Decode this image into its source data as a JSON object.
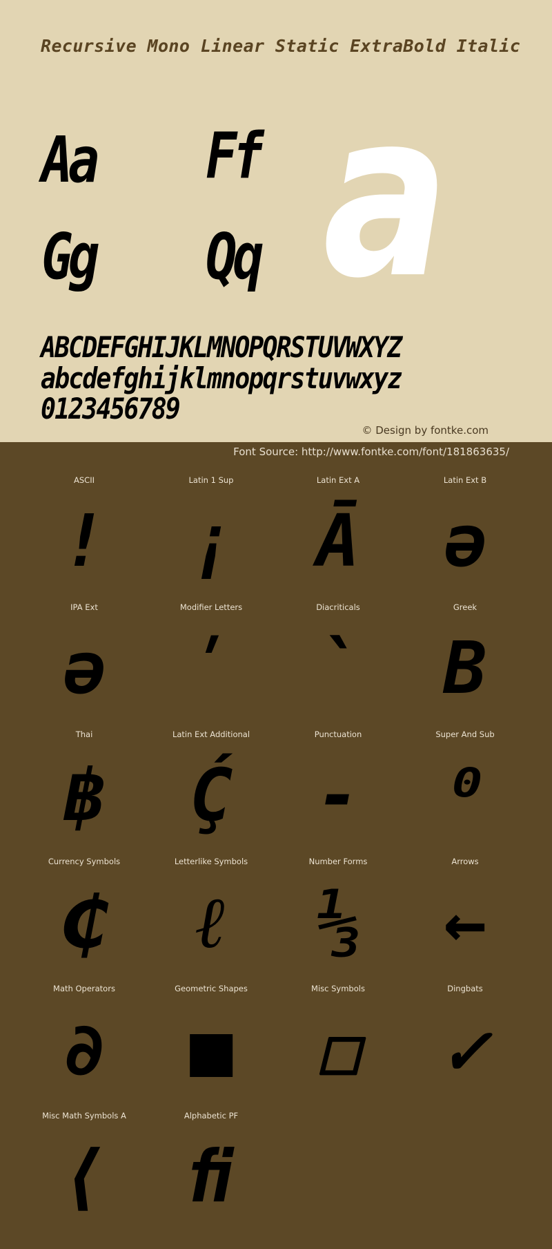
{
  "header": {
    "title": "Recursive Mono Linear Static ExtraBold Italic"
  },
  "specimen": {
    "pairs": [
      "Aa",
      "Ff",
      "Gg",
      "Qq"
    ],
    "big_glyph": "a",
    "uppercase": "ABCDEFGHIJKLMNOPQRSTUVWXYZ",
    "lowercase": "abcdefghijklmnopqrstuvwxyz",
    "digits": "0123456789",
    "credit": "© Design by fontke.com",
    "source": "Font Source: http://www.fontke.com/font/181863635/"
  },
  "colors": {
    "top_background": "#e2d5b3",
    "bottom_background": "#5c4826",
    "title_color": "#5a4422",
    "big_glyph_color": "#ffffff",
    "glyph_color": "#000000",
    "label_color": "#ece3d2"
  },
  "blocks": [
    {
      "label": "ASCII",
      "glyph": "!"
    },
    {
      "label": "Latin 1 Sup",
      "glyph": "¡"
    },
    {
      "label": "Latin Ext A",
      "glyph": "Ā"
    },
    {
      "label": "Latin Ext B",
      "glyph": "ə"
    },
    {
      "label": "IPA Ext",
      "glyph": "ə"
    },
    {
      "label": "Modifier Letters",
      "glyph": "ʹ"
    },
    {
      "label": "Diacriticals",
      "glyph": "̀"
    },
    {
      "label": "Greek",
      "glyph": "Β"
    },
    {
      "label": "Thai",
      "glyph": "฿"
    },
    {
      "label": "Latin Ext Additional",
      "glyph": "Ḉ"
    },
    {
      "label": "Punctuation",
      "glyph": "‐"
    },
    {
      "label": "Super And Sub",
      "glyph": "⁰"
    },
    {
      "label": "Currency Symbols",
      "glyph": "₵"
    },
    {
      "label": "Letterlike Symbols",
      "glyph": "ℓ"
    },
    {
      "label": "Number Forms",
      "glyph": "⅓"
    },
    {
      "label": "Arrows",
      "glyph": "←"
    },
    {
      "label": "Math Operators",
      "glyph": "∂"
    },
    {
      "label": "Geometric Shapes",
      "glyph": "■"
    },
    {
      "label": "Misc Symbols",
      "glyph": "☐"
    },
    {
      "label": "Dingbats",
      "glyph": "✓"
    },
    {
      "label": "Misc Math Symbols A",
      "glyph": "⟨"
    },
    {
      "label": "Alphabetic PF",
      "glyph": "ﬁ"
    }
  ]
}
